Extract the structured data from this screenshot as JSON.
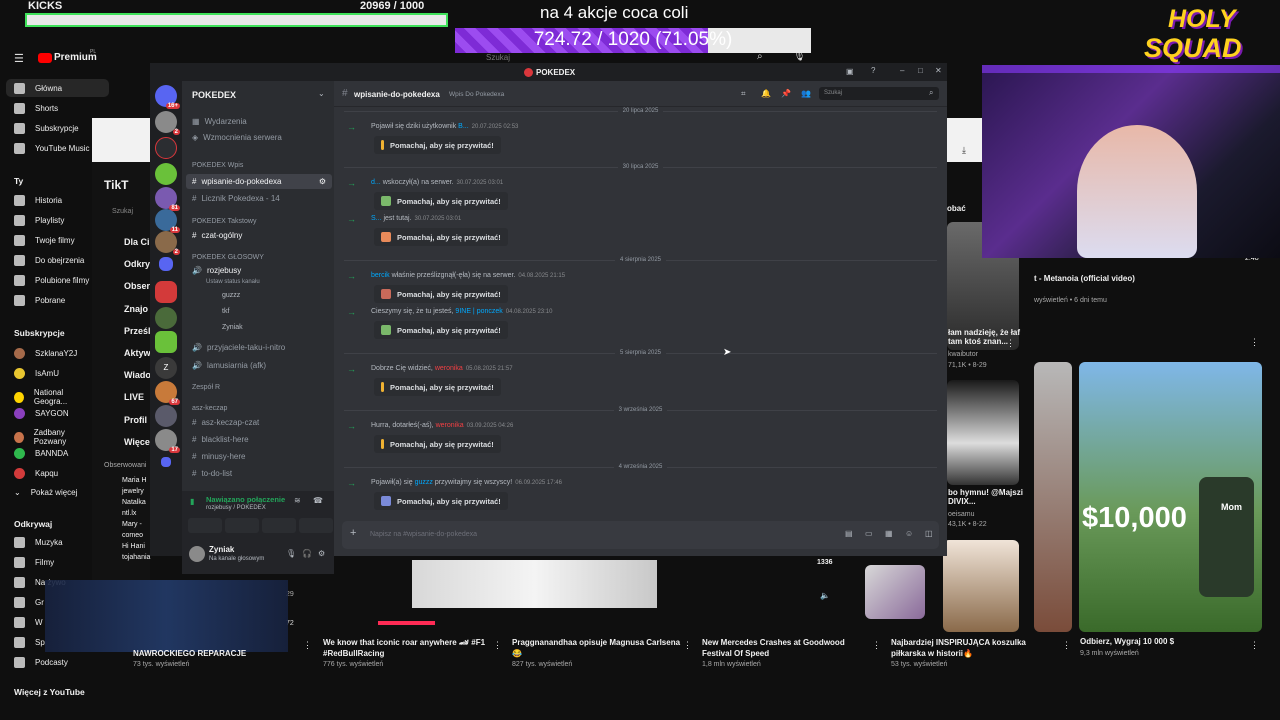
{
  "overlay": {
    "kicks_title": "KICKS",
    "kicks_count": "20969  / 1000",
    "kicks_progress": 1.0,
    "goal_title": "na 4 akcje coca coli",
    "goal_text": "724.72 / 1020 (71.05%)",
    "goal_progress": 0.7105,
    "logo_text_1": "HOLY",
    "logo_text_2": "SQUAD"
  },
  "youtube": {
    "brand": "Premium",
    "brand_sup": "PL",
    "search_placeholder": "Szukaj",
    "sidebar": {
      "main": [
        "Główna",
        "Shorts",
        "Subskrypcje",
        "YouTube Music"
      ],
      "you_heading": "Ty",
      "you": [
        "Historia",
        "Playlisty",
        "Twoje filmy",
        "Do obejrzenia",
        "Polubione filmy",
        "Pobrane"
      ],
      "subs_heading": "Subskrypcje",
      "subs": [
        "SzklanaY2J",
        "IsAmU",
        "National Geogra...",
        "SAYGON",
        "Zadbany Pozwany",
        "BANNDA",
        "Kapqu",
        "Pokaż więcej"
      ],
      "explore_heading": "Odkrywaj",
      "explore": [
        "Muzyka",
        "Filmy",
        "Na żywo",
        "Gr",
        "W",
        "Sp",
        "Podcasty"
      ],
      "more_heading": "Więcej z YouTube"
    },
    "tiktok": {
      "logo": "TikT",
      "search": "Szukaj",
      "menu": [
        "Dla Ci",
        "Odkry",
        "Obser",
        "Znajo",
        "Prześl",
        "Aktyw",
        "Wiado",
        "LIVE",
        "Profil",
        "Więce"
      ],
      "observed_heading": "Obserwowani",
      "observed": [
        "Maria H",
        "jewelry",
        "Natalka",
        "ntl.lx",
        "Mary -",
        "comeo",
        "Hi Hani",
        "tojahania"
      ]
    },
    "videos_bottom": [
      {
        "title": "NAWROCKIEGO REPARACJE",
        "meta": "73 tys. wyświetleń"
      },
      {
        "title": "We know that iconic roar anywhere 🏎 #F1 #RedBullRacing",
        "meta": "776 tys. wyświetleń"
      },
      {
        "title": "Praggnanandhaa opisuje Magnusa Carlsena 😂",
        "meta": "827 tys. wyświetleń"
      },
      {
        "title": "New Mercedes Crashes at Goodwood Festival Of Speed",
        "meta": "1,8 mln wyświetleń"
      },
      {
        "title": "Najbardziej INSPIRUJĄCA koszulka piłkarska w historii🔥",
        "meta": "53 tys. wyświetleń"
      },
      {
        "title": "Odbierz, Wygraj 10 000 $",
        "meta": "9,3 mln wyświetleń"
      }
    ],
    "right_videos": [
      {
        "title": "t - Metanoia (official video)",
        "meta": "wyświetleń • 6 dni temu"
      },
      {
        "title": "łam nadzieję, że łaf tam ktoś znan...",
        "meta": "71,1K • 8-29",
        "author": "kwaibutor"
      },
      {
        "title": "bo hymnu! @Majszi DIVIX...",
        "meta": "43,1K • 8-22",
        "author": "oeisamu"
      }
    ],
    "right_partial_label": "obać",
    "duration_label": "2:48",
    "mrbeast_amount": "$10,000",
    "mrbeast_contact": "Mom",
    "count_1336": "1336",
    "count_29": "29",
    "count_72": "72"
  },
  "discord": {
    "window_title": "POKEDEX",
    "guild": "POKEDEX",
    "channel_name": "wpisanie-do-pokedexa",
    "channel_topic": "Wpis Do Pokedexa",
    "search_placeholder": "Szukaj",
    "servers_badges": [
      "16+",
      "2",
      "81",
      "11",
      "2",
      "67",
      "17"
    ],
    "channels": {
      "events": "Wydarzenia",
      "boosts": "Wzmocnienia serwera",
      "cat_wpis": "POKEDEX Wpis",
      "ch_wpis": "wpisanie-do-pokedexa",
      "ch_licznik": "Licznik Pokedexa - 14",
      "cat_takstowy": "POKEDEX Takstowy",
      "ch_czat": "czat-ogólny",
      "cat_glosowy": "POKEDEX GŁOSOWY",
      "ch_voice": "rozjebusy",
      "voice_status": "Ustaw status kanału",
      "voice_users": [
        "guzzz",
        "tkf",
        "Zyniak"
      ],
      "ch_przyjaciele": "przyjaciele-taku-i-nitro",
      "ch_lamusiarnia": "lamusiarnia (afk)",
      "cat_zespol": "Zespół R",
      "cat_asz": "asz-keczap",
      "ch_asz": "asz-keczap-czat",
      "ch_blacklist": "blacklist-here",
      "ch_minusy": "minusy-here",
      "ch_todo": "to-do-list"
    },
    "voice_connected": "Nawiązano połączenie",
    "voice_where": "rozjebusy / POKEDEX",
    "user_name": "Zyniak",
    "user_status": "Na kanale głosowym",
    "composer_placeholder": "Napisz na #wpisanie-do-pokedexa",
    "wave_label": "Pomachaj, aby się przywitać!",
    "messages": [
      {
        "date": "20 lipca 2025"
      },
      {
        "text": "Pojawił się dziki użytkownik",
        "user": "B...",
        "ts": "20.07.2025 02:53"
      },
      {
        "date": "30 lipca 2025"
      },
      {
        "user": "d...",
        "text": "wskoczył(a) na serwer.",
        "ts": "30.07.2025 03:01"
      },
      {
        "user": "S...",
        "text": "jest tutaj.",
        "ts": "30.07.2025 03:01"
      },
      {
        "date": "4 sierpnia 2025"
      },
      {
        "user": "bercik",
        "text": "właśnie prześlizgnął(-ęła) się na serwer.",
        "ts": "04.08.2025 21:15"
      },
      {
        "text": "Cieszymy się, że tu jesteś,",
        "user": "9INE | ponczek",
        "ts": "04.08.2025 23:10"
      },
      {
        "date": "5 sierpnia 2025"
      },
      {
        "text": "Dobrze Cię widzieć,",
        "user": "weronika",
        "ts": "05.08.2025 21:57"
      },
      {
        "date": "3 września 2025"
      },
      {
        "text": "Hurra, dotarłeś(-aś),",
        "user": "weronika",
        "ts": "03.09.2025 04:26"
      },
      {
        "date": "4 września 2025"
      },
      {
        "text": "Pojawił(a) się",
        "user": "guzzz",
        "text2": "przywitajmy się wszyscy!",
        "ts": "06.09.2025 17:46"
      }
    ]
  }
}
